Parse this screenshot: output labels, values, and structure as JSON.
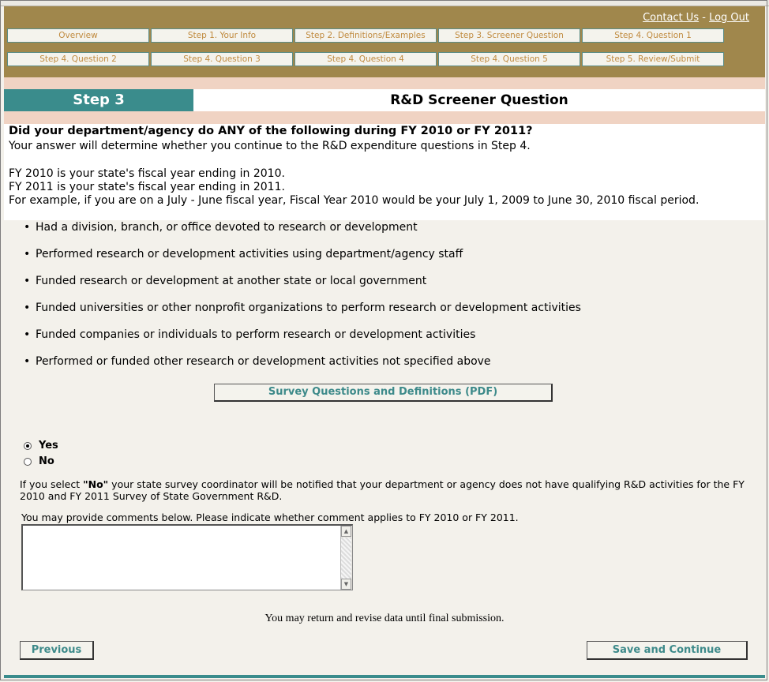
{
  "header": {
    "contact_label": "Contact Us",
    "separator": "-",
    "logout_label": "Log Out",
    "nav_row1": [
      "Overview",
      "Step 1. Your Info",
      "Step 2. Definitions/Examples",
      "Step 3. Screener Question",
      "Step 4. Question 1"
    ],
    "nav_row2": [
      "Step 4. Question 2",
      "Step 4. Question 3",
      "Step 4. Question 4",
      "Step 4. Question 5",
      "Step 5. Review/Submit"
    ]
  },
  "step": {
    "label": "Step 3",
    "title": "R&D Screener Question"
  },
  "intro": {
    "question": "Did your department/agency do ANY of the following during FY 2010 or FY 2011?",
    "line1": "Your answer will determine whether you continue to the R&D expenditure questions in Step 4.",
    "line2": "FY 2010 is your state's fiscal year ending in 2010.",
    "line3": "FY 2011 is your state's fiscal year ending in 2011.",
    "line4": "For example, if you are on a July - June fiscal year, Fiscal Year 2010 would be your July 1, 2009 to June 30, 2010 fiscal period."
  },
  "activities": [
    "Had a division, branch, or office devoted to research or development",
    "Performed research or development activities using department/agency staff",
    "Funded research or development at another state or local government",
    "Funded universities or other nonprofit organizations to perform research or development activities",
    "Funded companies or individuals to perform research or development activities",
    "Performed or funded other research or development activities not specified above"
  ],
  "pdf_button": "Survey Questions and Definitions (PDF)",
  "answer": {
    "yes_label": "Yes",
    "no_label": "No",
    "selected": "Yes"
  },
  "note": {
    "prefix": "If you select ",
    "emphasis": "\"No\"",
    "suffix": " your state survey coordinator will be notified that your department or agency does not have qualifying R&D activities for the FY 2010 and FY 2011 Survey of State Government R&D."
  },
  "comments": {
    "label": "You may provide comments below. Please indicate whether comment applies to FY 2010 or FY 2011.",
    "value": ""
  },
  "revise_text": "You may return and revise data until final submission.",
  "buttons": {
    "previous": "Previous",
    "save_continue": "Save and Continue"
  },
  "colors": {
    "header_bg": "#a0874c",
    "accent_teal": "#3a8c8c",
    "band_pink": "#f0d3c3",
    "nav_text": "#c08a3e"
  }
}
